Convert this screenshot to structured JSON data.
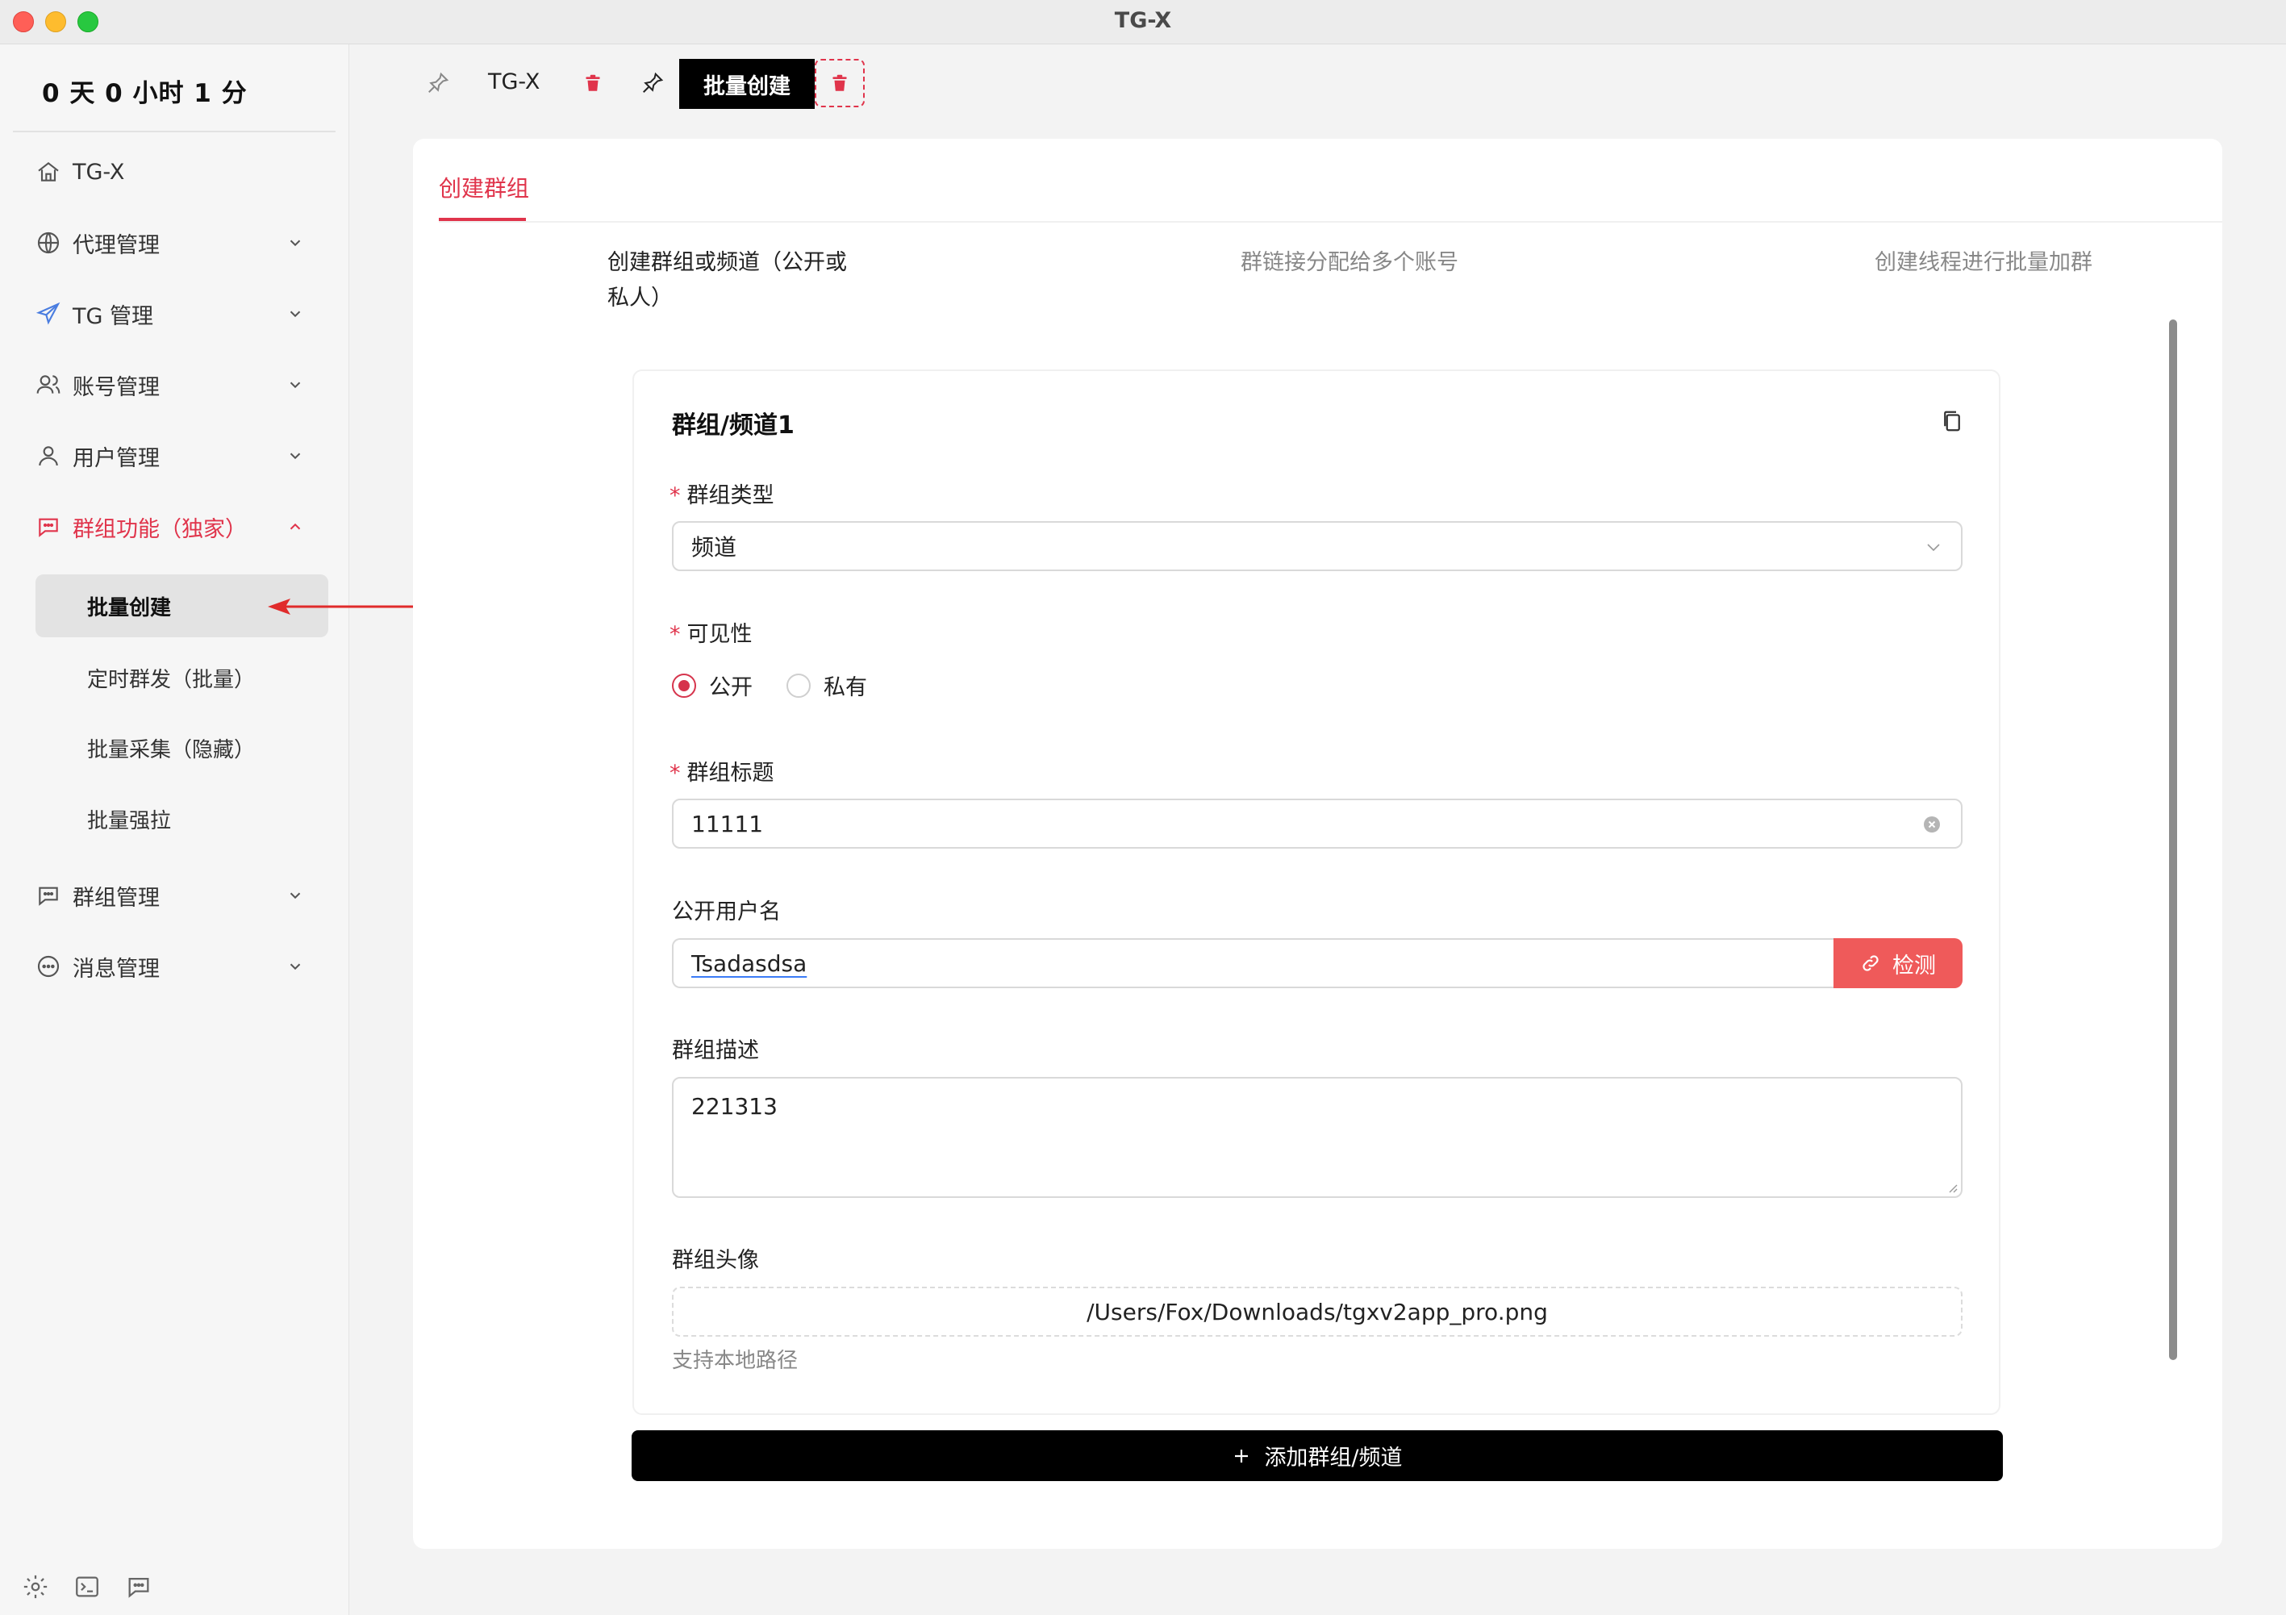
{
  "window": {
    "title": "TG-X"
  },
  "sidebar": {
    "uptime": "0 天 0 小时 1 分",
    "items": [
      {
        "label": "TG-X",
        "icon": "home-icon"
      },
      {
        "label": "代理管理",
        "icon": "globe-icon"
      },
      {
        "label": "TG 管理",
        "icon": "send-icon"
      },
      {
        "label": "账号管理",
        "icon": "users-icon"
      },
      {
        "label": "用户管理",
        "icon": "user-icon"
      },
      {
        "label": "群组功能（独家）",
        "icon": "chat-icon",
        "expanded": true
      },
      {
        "label": "群组管理",
        "icon": "chat-icon"
      },
      {
        "label": "消息管理",
        "icon": "message-dots-icon"
      }
    ],
    "subitems": [
      {
        "label": "批量创建",
        "active": true
      },
      {
        "label": "定时群发（批量）"
      },
      {
        "label": "批量采集（隐藏）"
      },
      {
        "label": "批量强拉"
      }
    ],
    "bottom_icons": [
      "gear-icon",
      "terminal-icon",
      "chat-icon"
    ]
  },
  "tabs": [
    {
      "label": "TG-X",
      "active": false
    },
    {
      "label": "批量创建",
      "active": true
    }
  ],
  "pane": {
    "tab": "创建群组",
    "steps": [
      "创建群组或频道（公开或私人）",
      "群链接分配给多个账号",
      "创建线程进行批量加群"
    ]
  },
  "form": {
    "card_title": "群组/频道1",
    "type_label": "群组类型",
    "type_value": "频道",
    "visibility_label": "可见性",
    "visibility_options": [
      "公开",
      "私有"
    ],
    "visibility_selected": "公开",
    "title_label": "群组标题",
    "title_value": "11111",
    "username_label": "公开用户名",
    "username_value": "Tsadasdsa",
    "check_button": "检测",
    "description_label": "群组描述",
    "description_value": "221313",
    "avatar_label": "群组头像",
    "avatar_path": "/Users/Fox/Downloads/tgxv2app_pro.png",
    "avatar_hint": "支持本地路径",
    "add_button": "添加群组/频道"
  },
  "colors": {
    "accent": "#e0344b",
    "check_button": "#ef5a5a",
    "primary_button": "#000000"
  }
}
